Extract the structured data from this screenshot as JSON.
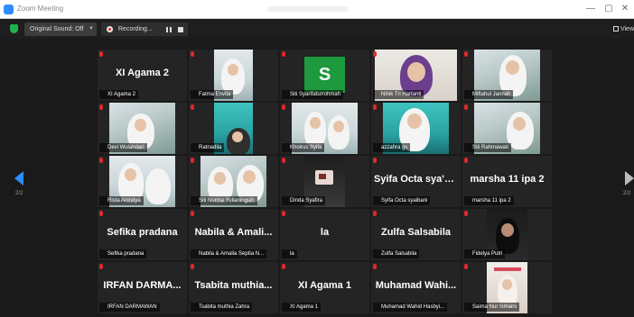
{
  "window": {
    "title": "Zoom Meeting",
    "min": "—",
    "max": "▢",
    "close": "✕"
  },
  "toolbar": {
    "sound_label": "Original Sound: Off",
    "recording_label": "Recording...",
    "view_label": "View"
  },
  "nav": {
    "prev_page": "2/2",
    "next_page": "2/2"
  },
  "colors": {
    "accent": "#2d8cff",
    "muted_mic": "#e02828",
    "avatar_green": "#1c9a3d"
  },
  "tiles": [
    {
      "big": "XI Agama 2",
      "label": "XI Agama 2"
    },
    {
      "label": "Fatma Envita"
    },
    {
      "avatar": "S",
      "label": "Siti Syarifaturrohmah"
    },
    {
      "label": "Nihik Tri Hartanti"
    },
    {
      "label": "Miftahul Jannah"
    },
    {
      "label": "Devi Wulandari"
    },
    {
      "label": "Ratnadila"
    },
    {
      "label": "Khoirus Syifa"
    },
    {
      "label": "azzahra gs"
    },
    {
      "label": "Siti Rahmawati"
    },
    {
      "label": "Rista Anindya"
    },
    {
      "label": "Siti Nurma Yulianingsih"
    },
    {
      "label": "Dinda Syafira"
    },
    {
      "big": "Syifa Octa sya'b...",
      "label": "Syifa Octa syaibani"
    },
    {
      "big": "marsha 11 ipa 2",
      "label": "marsha 11 ipa 2"
    },
    {
      "big": "Sefika pradana",
      "label": "Sefika pradana"
    },
    {
      "big": "Nabila & Amali...",
      "label": "Nabila & Amalia Septia N..."
    },
    {
      "big": "la",
      "label": "la"
    },
    {
      "big": "Zulfa Salsabila",
      "label": "Zulfa Salsabila"
    },
    {
      "label": "Fidelya Putri"
    },
    {
      "big": "IRFAN DARMA...",
      "label": "IRFAN DARMAWAN"
    },
    {
      "big": "Tsabita muthia...",
      "label": "Tsabita muthia Zahra"
    },
    {
      "big": "XI Agama 1",
      "label": "XI Agama 1"
    },
    {
      "big": "Muhamad Wahi...",
      "label": "Muhamad Wahid Hasbyi..."
    },
    {
      "label": "Saima Nur Ismaini"
    }
  ]
}
